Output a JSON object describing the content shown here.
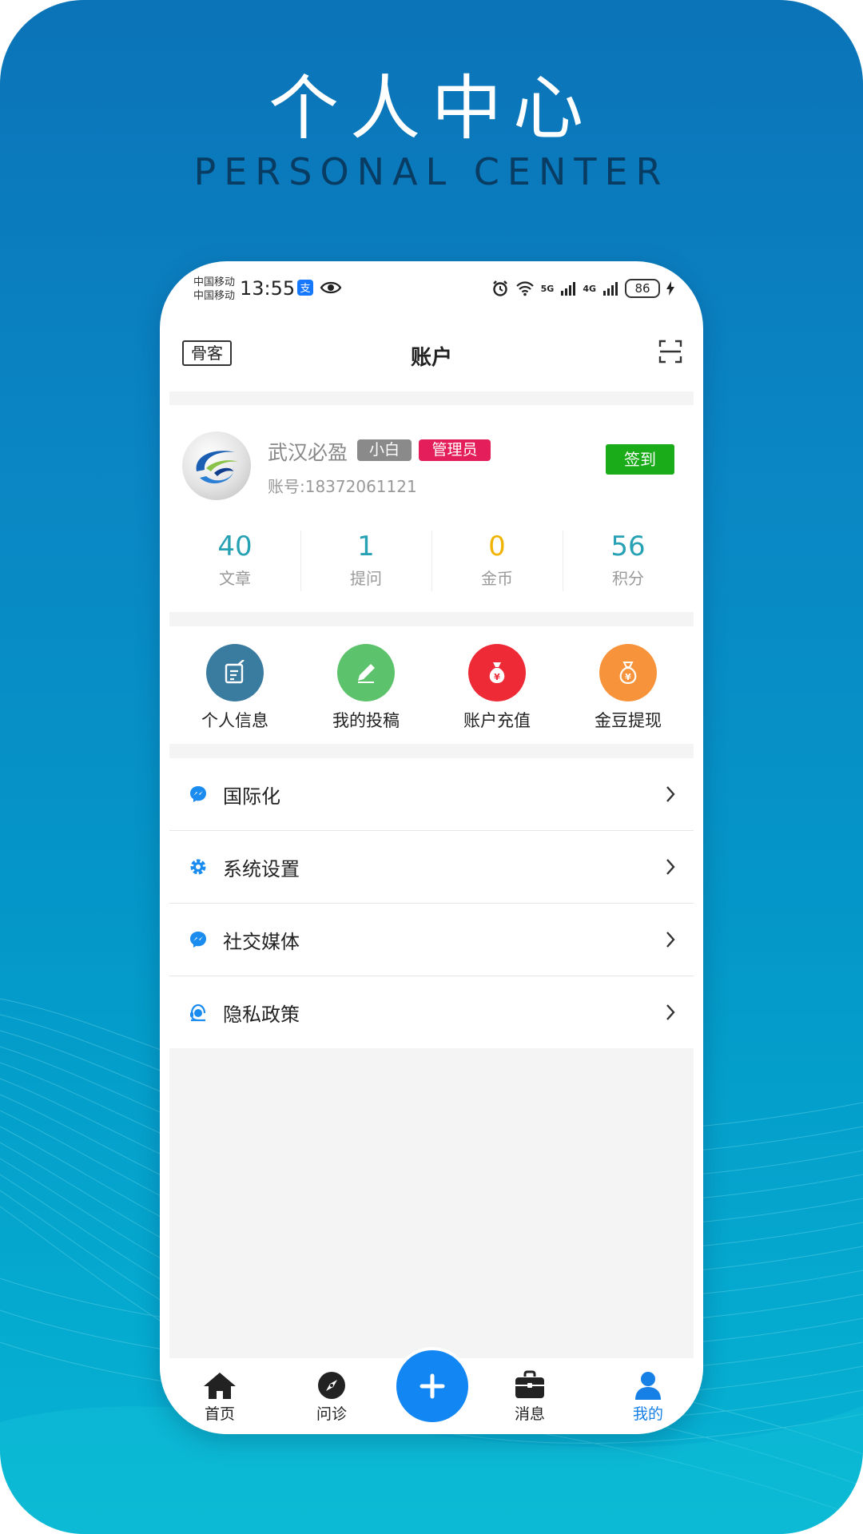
{
  "poster": {
    "title": "个人中心",
    "subtitle": "PERSONAL CENTER"
  },
  "status_bar": {
    "carrier_1": "中国移动",
    "carrier_2": "中国移动",
    "time": "13:55",
    "network_1": "5G",
    "network_2": "4G",
    "battery": "86"
  },
  "navbar": {
    "guest_label": "骨客",
    "title": "账户"
  },
  "profile": {
    "name": "武汉必盈",
    "tag_level": "小白",
    "tag_role": "管理员",
    "account": "账号:18372061121",
    "signin_label": "签到"
  },
  "stats": [
    {
      "value": "40",
      "label": "文章",
      "color": "#27a1b4"
    },
    {
      "value": "1",
      "label": "提问",
      "color": "#27a1b4"
    },
    {
      "value": "0",
      "label": "金币",
      "color": "#f0b400"
    },
    {
      "value": "56",
      "label": "积分",
      "color": "#27a1b4"
    }
  ],
  "shortcuts": [
    {
      "label": "个人信息",
      "icon": "edit-note-icon",
      "color": "#3a7ba0"
    },
    {
      "label": "我的投稿",
      "icon": "pencil-icon",
      "color": "#5cc26b"
    },
    {
      "label": "账户充值",
      "icon": "money-bag-icon",
      "color": "#ee2a37"
    },
    {
      "label": "金豆提现",
      "icon": "coin-bag-icon",
      "color": "#f7933b"
    }
  ],
  "menu": [
    {
      "label": "国际化",
      "icon": "messenger-icon"
    },
    {
      "label": "系统设置",
      "icon": "gear-icon"
    },
    {
      "label": "社交媒体",
      "icon": "messenger-icon"
    },
    {
      "label": "隐私政策",
      "icon": "support-agent-icon"
    }
  ],
  "tabbar": [
    {
      "label": "首页",
      "icon": "home-icon"
    },
    {
      "label": "问诊",
      "icon": "compass-icon"
    },
    {
      "label": "消息",
      "icon": "briefcase-icon"
    },
    {
      "label": "我的",
      "icon": "user-icon",
      "active": true
    }
  ],
  "colors": {
    "accent": "#1286f2",
    "signin": "#1aad19",
    "tag_red": "#e31e5a",
    "tag_gray": "#8a8a8a"
  }
}
